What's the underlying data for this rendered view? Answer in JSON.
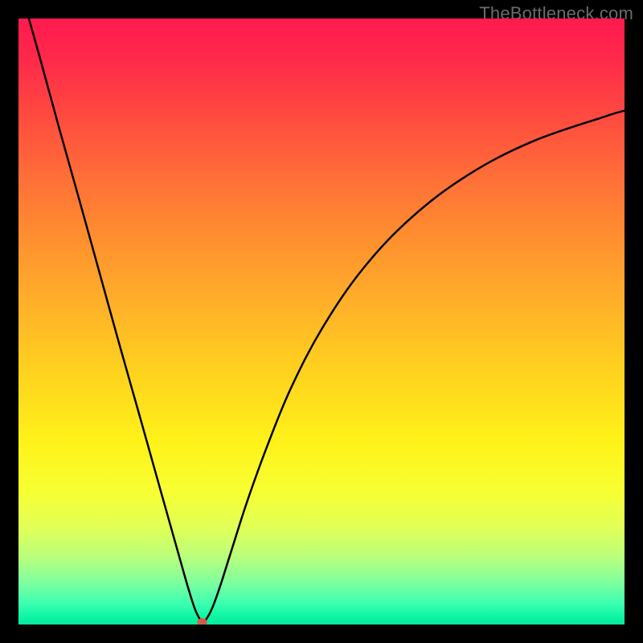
{
  "watermark": "TheBottleneck.com",
  "chart_data": {
    "type": "line",
    "title": "",
    "xlabel": "",
    "ylabel": "",
    "xlim": [
      0,
      1
    ],
    "ylim": [
      0,
      1
    ],
    "grid": false,
    "legend": false,
    "series": [
      {
        "name": "curve",
        "x": [
          0.0,
          0.034,
          0.066,
          0.1,
          0.133,
          0.166,
          0.2,
          0.232,
          0.265,
          0.281,
          0.291,
          0.298,
          0.303,
          0.31,
          0.32,
          0.333,
          0.352,
          0.378,
          0.411,
          0.45,
          0.503,
          0.57,
          0.649,
          0.742,
          0.848,
          0.967,
          1.0
        ],
        "y": [
          1.06,
          0.94,
          0.823,
          0.702,
          0.583,
          0.464,
          0.344,
          0.23,
          0.113,
          0.057,
          0.026,
          0.011,
          0.004,
          0.009,
          0.028,
          0.064,
          0.124,
          0.205,
          0.296,
          0.391,
          0.492,
          0.589,
          0.672,
          0.742,
          0.797,
          0.838,
          0.848
        ]
      }
    ],
    "marker": {
      "x": 0.303,
      "y": 0.004
    },
    "background": {
      "type": "vertical-gradient",
      "stops": [
        {
          "t": 0.0,
          "color": "#ff1a4f"
        },
        {
          "t": 0.58,
          "color": "#ffd11f"
        },
        {
          "t": 0.94,
          "color": "#3dffb0"
        },
        {
          "t": 1.0,
          "color": "#06e99a"
        }
      ]
    }
  }
}
